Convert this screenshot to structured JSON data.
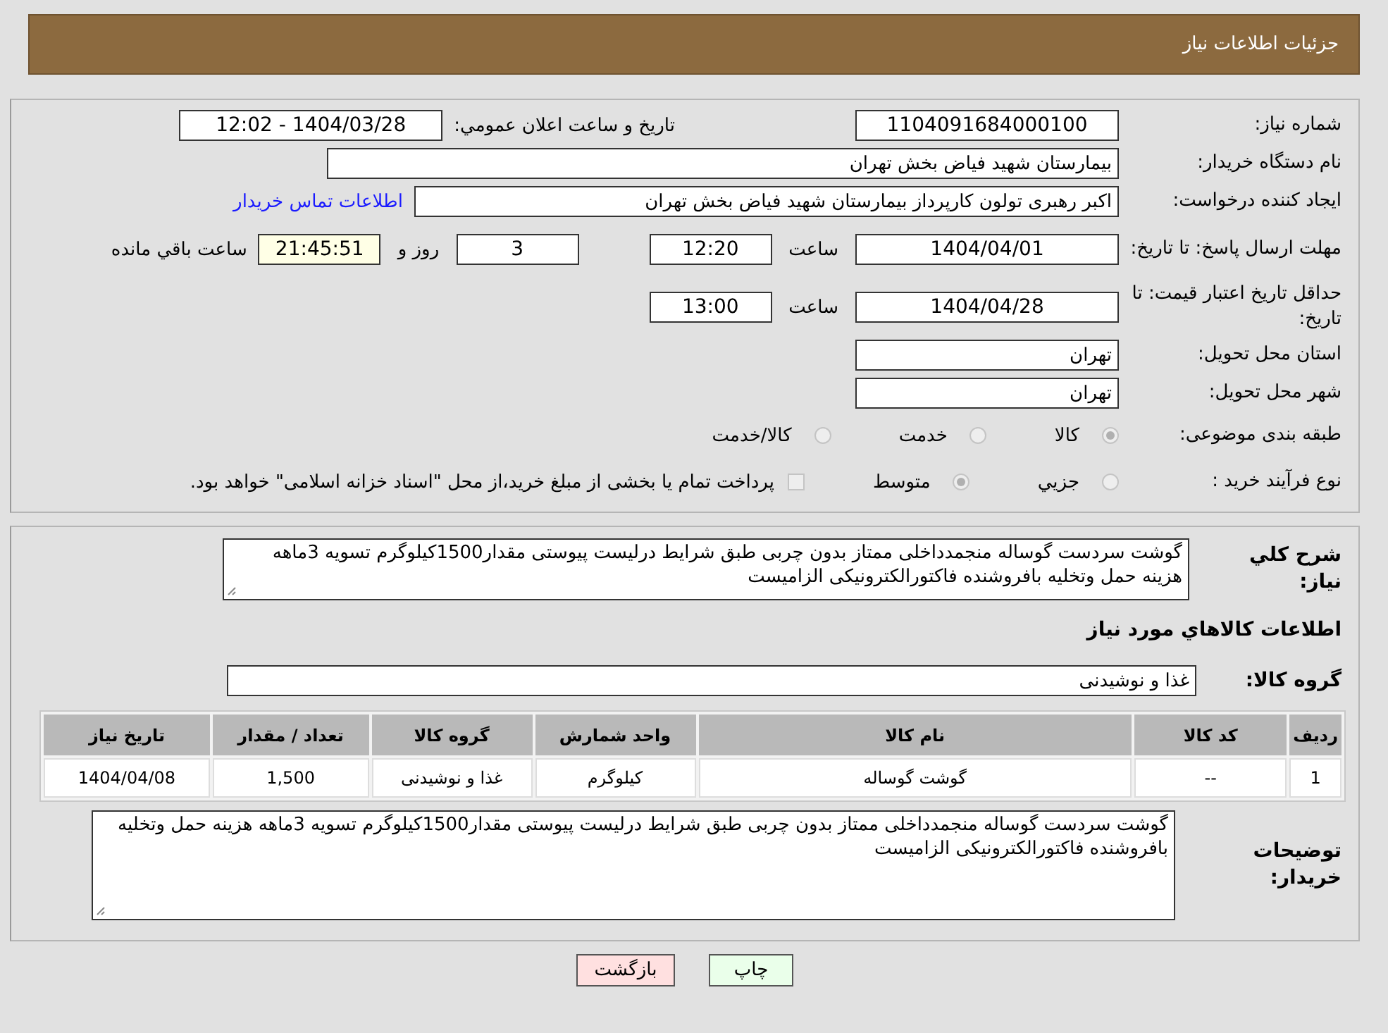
{
  "header": {
    "title": "جزئیات اطلاعات نیاز"
  },
  "need_number": {
    "label": "شماره نیاز:",
    "value": "1104091684000100"
  },
  "announce": {
    "label": "تاریخ و ساعت اعلان عمومي:",
    "value": "1404/03/28 - 12:02"
  },
  "buyer_org": {
    "label": "نام دستگاه خریدار:",
    "value": "بیمارستان شهید فیاض بخش تهران"
  },
  "requester": {
    "label": "ایجاد کننده درخواست:",
    "value": "اکبر رهبری تولون کارپرداز بیمارستان شهید فیاض بخش تهران",
    "link": "اطلاعات تماس خریدار"
  },
  "deadline": {
    "label": "مهلت ارسال پاسخ: تا تاریخ:",
    "date": "1404/04/01",
    "time_label": "ساعت",
    "time": "12:20",
    "days": "3",
    "days_label": "روز و",
    "remaining": "21:45:51",
    "remaining_label": "ساعت باقي مانده"
  },
  "validity": {
    "label": "حداقل تاریخ اعتبار قیمت: تا تاریخ:",
    "date": "1404/04/28",
    "time_label": "ساعت",
    "time": "13:00"
  },
  "province": {
    "label": "استان محل تحویل:",
    "value": "تهران"
  },
  "city": {
    "label": "شهر محل تحویل:",
    "value": "تهران"
  },
  "category": {
    "label": "طبقه بندی موضوعی:",
    "options": [
      {
        "label": "کالا",
        "selected": true
      },
      {
        "label": "خدمت",
        "selected": false
      },
      {
        "label": "کالا/خدمت",
        "selected": false
      }
    ]
  },
  "purchase_type": {
    "label": "نوع فرآیند خرید :",
    "options": [
      {
        "label": "جزيي",
        "selected": false
      },
      {
        "label": "متوسط",
        "selected": true
      }
    ],
    "payment": {
      "checked": false,
      "text": "پرداخت تمام یا بخشی از مبلغ خرید،از محل \"اسناد خزانه اسلامی\" خواهد بود."
    }
  },
  "summary": {
    "label": "شرح کلي نیاز:",
    "value": "گوشت سردست گوساله منجمدداخلی ممتاز بدون چربی طبق شرایط درلیست پیوستی مقدار1500کیلوگرم تسویه 3ماهه هزینه حمل وتخلیه بافروشنده فاکتورالکترونیکی الزامیست"
  },
  "goods_heading": "اطلاعات کالاهاي مورد نیاز",
  "goods_group": {
    "label": "گروه کالا:",
    "value": "غذا و نوشیدنی"
  },
  "table": {
    "columns": [
      "ردیف",
      "کد کالا",
      "نام کالا",
      "واحد شمارش",
      "گروه کالا",
      "تعداد / مقدار",
      "تاریخ نیاز"
    ],
    "rows": [
      [
        "1",
        "--",
        "گوشت گوساله",
        "کیلوگرم",
        "غذا و نوشیدنی",
        "1,500",
        "1404/04/08"
      ]
    ]
  },
  "buyer_notes": {
    "label": "توضیحات خریدار:",
    "value": "گوشت سردست گوساله منجمدداخلی ممتاز بدون چربی طبق شرایط درلیست پیوستی مقدار1500کیلوگرم تسویه 3ماهه هزینه حمل وتخلیه بافروشنده فاکتورالکترونیکی الزامیست"
  },
  "buttons": [
    {
      "kind": "print",
      "label": "چاپ"
    },
    {
      "kind": "back",
      "label": "بازگشت"
    }
  ]
}
